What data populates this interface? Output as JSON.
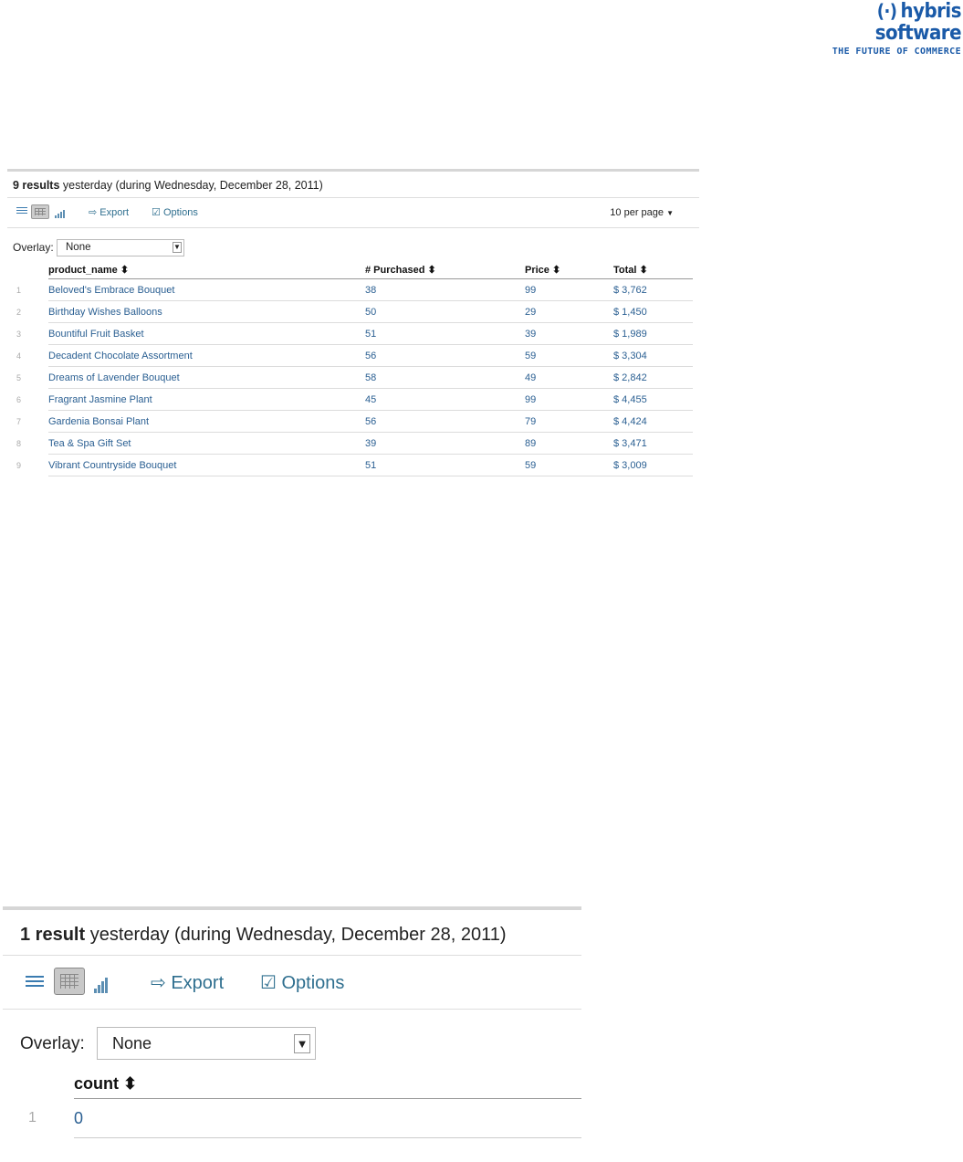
{
  "logo": {
    "mark": "(·)",
    "name": "hybris software",
    "tagline": "THE FUTURE OF COMMERCE"
  },
  "panel1": {
    "count_text": "9 results",
    "period_text": " yesterday (during Wednesday, December 28, 2011)",
    "toolbar": {
      "export": "Export",
      "options": "Options",
      "per_page": "10 per page"
    },
    "overlay_label": "Overlay:",
    "overlay_value": "None",
    "columns": [
      "product_name",
      "# Purchased",
      "Price",
      "Total"
    ],
    "rows": [
      {
        "n": "1",
        "name": "Beloved's Embrace Bouquet",
        "purchased": "38",
        "price": "99",
        "total": "$ 3,762"
      },
      {
        "n": "2",
        "name": "Birthday Wishes Balloons",
        "purchased": "50",
        "price": "29",
        "total": "$ 1,450"
      },
      {
        "n": "3",
        "name": "Bountiful Fruit Basket",
        "purchased": "51",
        "price": "39",
        "total": "$ 1,989"
      },
      {
        "n": "4",
        "name": "Decadent Chocolate Assortment",
        "purchased": "56",
        "price": "59",
        "total": "$ 3,304"
      },
      {
        "n": "5",
        "name": "Dreams of Lavender Bouquet",
        "purchased": "58",
        "price": "49",
        "total": "$ 2,842"
      },
      {
        "n": "6",
        "name": "Fragrant Jasmine Plant",
        "purchased": "45",
        "price": "99",
        "total": "$ 4,455"
      },
      {
        "n": "7",
        "name": "Gardenia Bonsai Plant",
        "purchased": "56",
        "price": "79",
        "total": "$ 4,424"
      },
      {
        "n": "8",
        "name": "Tea & Spa Gift Set",
        "purchased": "39",
        "price": "89",
        "total": "$ 3,471"
      },
      {
        "n": "9",
        "name": "Vibrant Countryside Bouquet",
        "purchased": "51",
        "price": "59",
        "total": "$ 3,009"
      }
    ]
  },
  "panel2": {
    "count_text": "1 result",
    "period_text": " yesterday (during Wednesday, December 28, 2011)",
    "toolbar": {
      "export": "Export",
      "options": "Options"
    },
    "overlay_label": "Overlay:",
    "overlay_value": "None",
    "columns": [
      "count"
    ],
    "rows": [
      {
        "n": "1",
        "count": "0"
      }
    ]
  },
  "icons": {
    "sort": "sort-icon",
    "list": "list-view-icon",
    "table": "table-view-icon",
    "chart": "chart-view-icon",
    "export": "export-icon",
    "options": "options-icon",
    "dropdown": "dropdown-arrow-icon"
  },
  "colors": {
    "link": "#2a5f92",
    "brand": "#1a5aa8"
  }
}
